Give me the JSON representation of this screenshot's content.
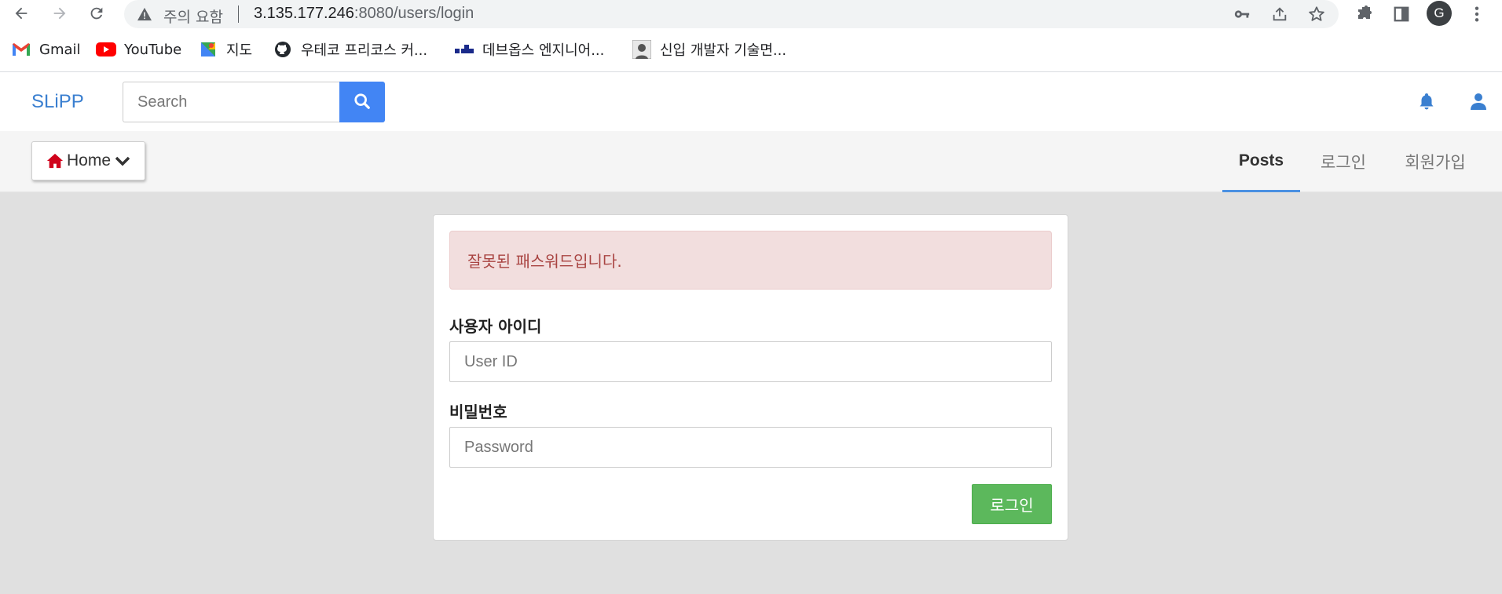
{
  "browser": {
    "security_label": "주의 요함",
    "url_host": "3.135.177.246",
    "url_rest": ":8080/users/login",
    "profile_initial": "G",
    "icons": {
      "back": "back-arrow-icon",
      "forward": "forward-arrow-icon",
      "reload": "reload-icon",
      "warning": "warning-icon",
      "key": "key-icon",
      "share": "share-icon",
      "star": "star-icon",
      "extensions": "puzzle-icon",
      "side_panel": "side-panel-icon",
      "menu": "kebab-menu-icon"
    },
    "bookmarks": [
      {
        "label": "Gmail",
        "icon": "gmail-icon"
      },
      {
        "label": "YouTube",
        "icon": "youtube-icon"
      },
      {
        "label": "지도",
        "icon": "maps-icon"
      },
      {
        "label": "우테코 프리코스 커...",
        "icon": "github-icon"
      },
      {
        "label": "데브옵스 엔지니어...",
        "icon": "devops-icon"
      },
      {
        "label": "신입 개발자 기술면...",
        "icon": "avatar-thumb-icon"
      }
    ]
  },
  "navbar": {
    "brand": "SLiPP",
    "search_placeholder": "Search",
    "accent_color": "#4285f4"
  },
  "subnav": {
    "home_label": "Home",
    "tabs": [
      {
        "label": "Posts",
        "active": true
      },
      {
        "label": "로그인",
        "active": false
      },
      {
        "label": "회원가입",
        "active": false
      }
    ]
  },
  "login": {
    "error_message": "잘못된 패스워드입니다.",
    "userid_label": "사용자 아이디",
    "userid_placeholder": "User ID",
    "password_label": "비밀번호",
    "password_placeholder": "Password",
    "submit_label": "로그인",
    "submit_color": "#5cb85c",
    "error_bg_color": "#f2dede"
  }
}
